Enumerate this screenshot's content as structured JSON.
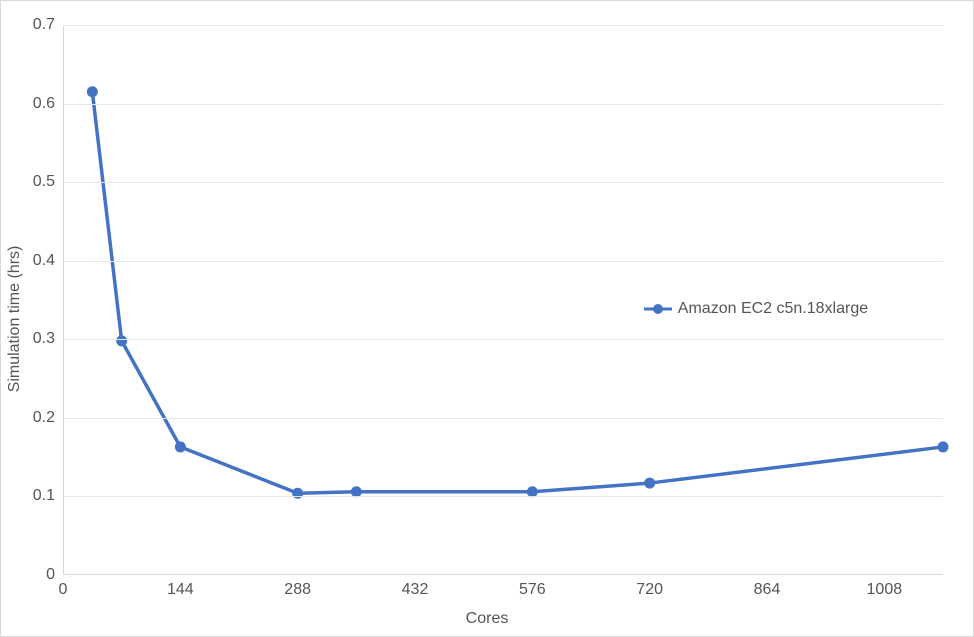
{
  "chart_data": {
    "type": "line",
    "title": "",
    "xlabel": "Cores",
    "ylabel": "Simulation time (hrs)",
    "xlim": [
      0,
      1080
    ],
    "ylim": [
      0,
      0.7
    ],
    "x_ticks": [
      0,
      144,
      288,
      432,
      576,
      720,
      864,
      1008
    ],
    "y_ticks": [
      0,
      0.1,
      0.2,
      0.3,
      0.4,
      0.5,
      0.6,
      0.7
    ],
    "series": [
      {
        "name": "Amazon EC2 c5n.18xlarge",
        "color": "#4472c4",
        "x": [
          36,
          72,
          144,
          288,
          360,
          576,
          720,
          1080
        ],
        "y": [
          0.615,
          0.298,
          0.163,
          0.104,
          0.106,
          0.106,
          0.117,
          0.163
        ]
      }
    ],
    "legend_position": {
      "x_frac": 0.66,
      "y_frac": 0.5
    }
  }
}
